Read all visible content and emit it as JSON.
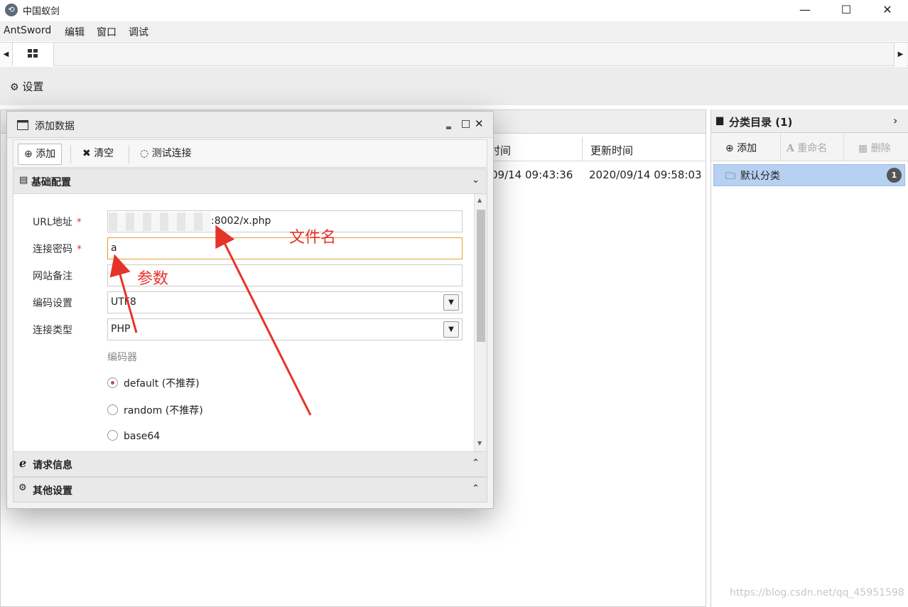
{
  "window": {
    "title": "中国蚁剑",
    "minimize": "—",
    "maximize": "☐",
    "close": "✕"
  },
  "menu": [
    "AntSword",
    "编辑",
    "窗口",
    "调试"
  ],
  "tabs": {
    "left_arrow": "◀",
    "right_arrow": "▶"
  },
  "toolbar": {
    "settings_label": "设置"
  },
  "grid": {
    "columns": [
      "时间",
      "更新时间"
    ],
    "row": {
      "created": "09/14 09:43:36",
      "updated": "2020/09/14 09:58:03"
    }
  },
  "category_panel": {
    "title": "分类目录 (1)",
    "add_label": "添加",
    "rename_label": "重命名",
    "delete_label": "删除",
    "items": [
      {
        "label": "默认分类",
        "count": "1"
      }
    ]
  },
  "dialog": {
    "title": "添加数据",
    "toolbar": {
      "add_label": "添加",
      "clear_label": "清空",
      "test_label": "测试连接"
    },
    "section_basic": "基础配置",
    "section_request": "请求信息",
    "section_other": "其他设置",
    "fields": {
      "url_label": "URL地址",
      "url_value": ":8002/x.php",
      "password_label": "连接密码",
      "password_value": "a",
      "note_label": "网站备注",
      "note_value": "",
      "encoding_label": "编码设置",
      "encoding_value": "UTF8",
      "type_label": "连接类型",
      "type_value": "PHP",
      "required_mark": "*"
    },
    "encoder": {
      "title": "编码器",
      "options": [
        {
          "label": "default (不推荐)",
          "checked": true
        },
        {
          "label": "random (不推荐)",
          "checked": false
        },
        {
          "label": "base64",
          "checked": false
        }
      ]
    }
  },
  "annotations": {
    "filename": "文件名",
    "param": "参数"
  },
  "watermark": "https://blog.csdn.net/qq_45951598",
  "colors": {
    "annotation": "#e6332a",
    "selected_item": "#b6d1f2",
    "focus_border": "#e0a030"
  }
}
